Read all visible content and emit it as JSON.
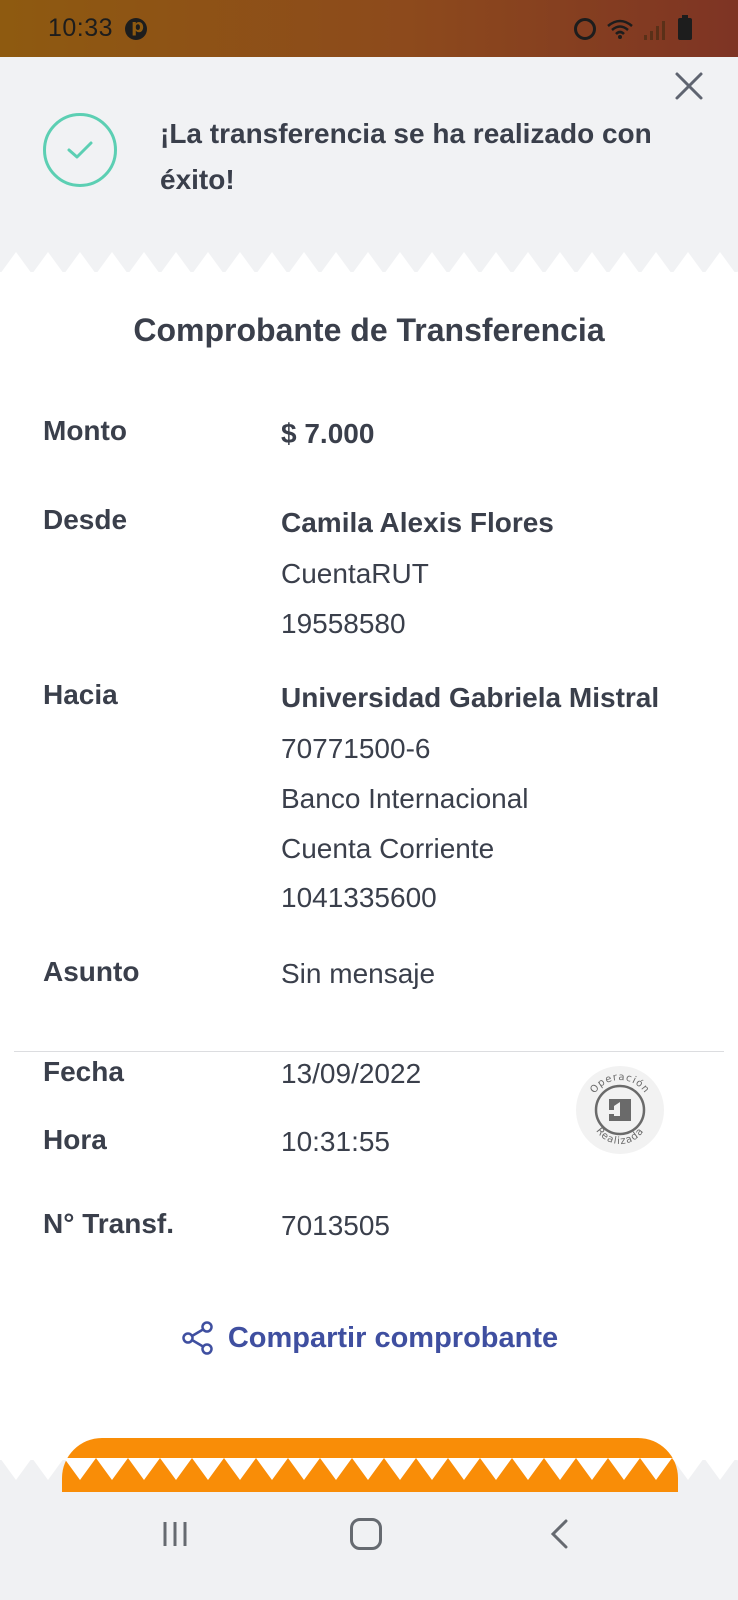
{
  "status_bar": {
    "time": "10:33",
    "icons": [
      "pinterest-icon",
      "alarm-icon",
      "wifi-icon",
      "signal-icon",
      "battery-icon"
    ]
  },
  "banner": {
    "message": "¡La transferencia se ha realizado con éxito!",
    "icon": "check-circle-icon",
    "close_icon": "close-icon"
  },
  "receipt": {
    "title": "Comprobante de Transferencia",
    "monto": {
      "label": "Monto",
      "value": "$ 7.000"
    },
    "desde": {
      "label": "Desde",
      "name": "Camila Alexis Flores",
      "account_type": "CuentaRUT",
      "account_number": "19558580"
    },
    "hacia": {
      "label": "Hacia",
      "name": "Universidad Gabriela Mistral",
      "rut": "70771500-6",
      "bank": "Banco Internacional",
      "account_type": "Cuenta Corriente",
      "account_number": "1041335600"
    },
    "asunto": {
      "label": "Asunto",
      "value": "Sin mensaje"
    },
    "fecha": {
      "label": "Fecha",
      "value": "13/09/2022"
    },
    "hora": {
      "label": "Hora",
      "value": "10:31:55"
    },
    "transf": {
      "label": "N° Transf.",
      "value": "7013505"
    },
    "stamp": {
      "top_text": "Operación",
      "bottom_text": "Realizada"
    }
  },
  "share": {
    "label": "Compartir comprobante",
    "icon": "share-icon"
  },
  "colors": {
    "accent_orange": "#f98d07",
    "link_blue": "#3f4fa0",
    "success_green": "#5ccfb3",
    "text_dark": "#3a3f4b"
  },
  "navbar": {
    "icons": [
      "recent-apps-icon",
      "home-icon",
      "back-icon"
    ]
  }
}
